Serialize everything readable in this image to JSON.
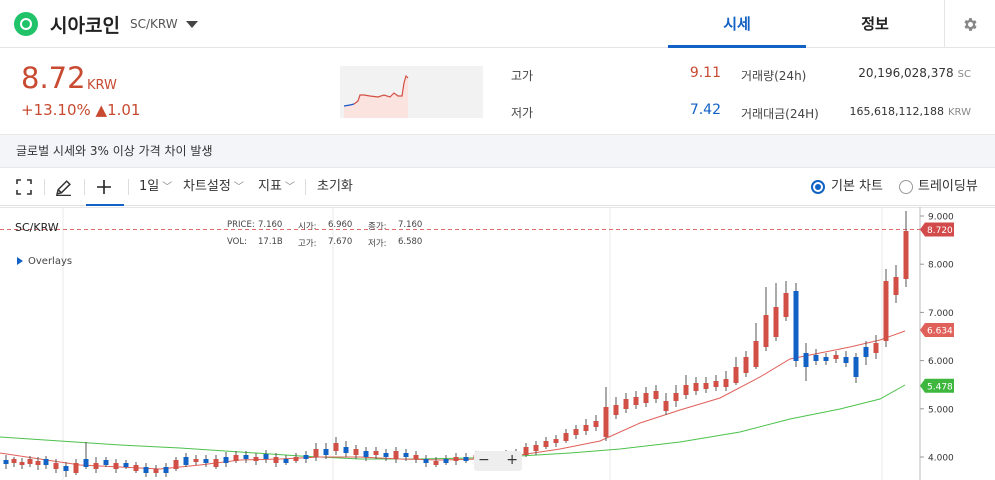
{
  "header": {
    "coin_name": "시아코인",
    "pair": "SC/KRW",
    "tabs": [
      {
        "label": "시세"
      },
      {
        "label": "정보"
      }
    ]
  },
  "summary": {
    "price": "8.72",
    "unit": "KRW",
    "change": "+13.10% ▲1.01",
    "high_label": "고가",
    "high_value": "9.11",
    "low_label": "저가",
    "low_value": "7.42",
    "volume_label": "거래량(24h)",
    "volume_value": "20,196,028,378",
    "volume_unit": "SC",
    "amount_label": "거래대금(24H)",
    "amount_value": "165,618,112,188",
    "amount_unit": "KRW"
  },
  "notice": "글로벌 시세와 3% 이상 가격 차이 발생",
  "toolbar": {
    "interval": "1일",
    "chart_settings": "차트설정",
    "indicators": "지표",
    "reset": "초기화",
    "basic_chart": "기본 차트",
    "tradingview": "트레이딩뷰"
  },
  "chart": {
    "pair": "SC/KRW",
    "ohlc_row1": [
      "PRICE:",
      "7.160",
      "시가:",
      "6.960",
      "종가:",
      "7.160"
    ],
    "ohlc_row2": [
      "VOL:",
      "17.1B",
      "고가:",
      "7.670",
      "저가:",
      "6.580"
    ],
    "overlays_label": "Overlays",
    "price_label": "8.720",
    "ma_short_label": "6.634",
    "ma_long_label": "5.478",
    "y_ticks": [
      "9.000",
      "8.000",
      "7.000",
      "6.000",
      "5.000",
      "4.000"
    ],
    "zoom_out": "−",
    "zoom_in": "+"
  },
  "colors": {
    "accent": "#1261c4",
    "up": "#d24f45",
    "down": "#1261c4",
    "ma_short": "#e0605a",
    "ma_long": "#4cc24c",
    "coin": "#20c36a"
  }
}
